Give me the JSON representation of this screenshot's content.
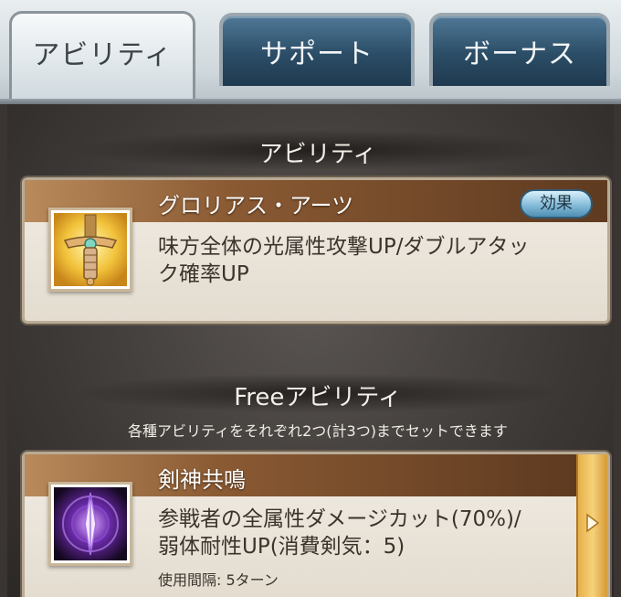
{
  "tabs": {
    "ability": "アビリティ",
    "support": "サポート",
    "bonus": "ボーナス"
  },
  "ability_section": {
    "title": "アビリティ",
    "card": {
      "name": "グロリアス・アーツ",
      "effect_button": "効果",
      "description_line1": "味方全体の光属性攻撃UP/ダブルアタッ",
      "description_line2": "ク確率UP",
      "icon": "golden-sword-hilt-icon"
    }
  },
  "free_section": {
    "title": "Freeアビリティ",
    "subtitle": "各種アビリティをそれぞれ2つ(計3つ)までセットできます",
    "card": {
      "name": "剣神共鳴",
      "description_line1": "参戦者の全属性ダメージカット(70%)/",
      "description_line2": "弱体耐性UP(消費剣気：5)",
      "interval": "使用間隔: 5ターン",
      "icon": "purple-blade-icon"
    }
  },
  "colors": {
    "tab_active": "#dfe6ea",
    "tab_inactive": "#2b4d66",
    "card_header": "#8a5a33",
    "effect_button": "#7fb7d6",
    "side_arrow": "#e7b04a"
  }
}
